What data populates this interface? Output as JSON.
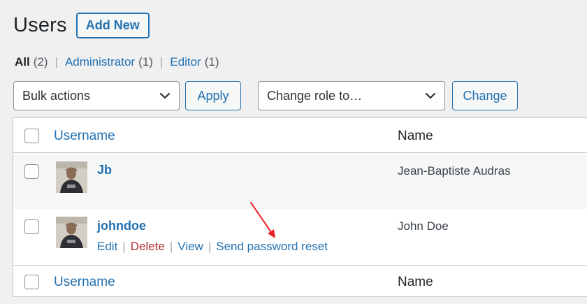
{
  "header": {
    "title": "Users",
    "add_new_label": "Add New"
  },
  "views": [
    {
      "label": "All",
      "count": "(2)",
      "current": true
    },
    {
      "label": "Administrator",
      "count": "(1)",
      "current": false
    },
    {
      "label": "Editor",
      "count": "(1)",
      "current": false
    }
  ],
  "tablenav": {
    "bulk_select": "Bulk actions",
    "apply_label": "Apply",
    "role_select": "Change role to…",
    "change_label": "Change"
  },
  "table": {
    "columns": {
      "username": "Username",
      "name": "Name"
    },
    "rows": [
      {
        "username": "Jb",
        "name": "Jean-Baptiste Audras",
        "actions_visible": false
      },
      {
        "username": "johndoe",
        "name": "John Doe",
        "actions_visible": true
      }
    ],
    "row_actions": {
      "edit": "Edit",
      "delete": "Delete",
      "view": "View",
      "reset": "Send password reset"
    }
  },
  "colors": {
    "accent": "#2271b1",
    "danger": "#b32d2e",
    "arrow": "#e8202a"
  },
  "icons": {
    "select_chevron": "chevron-down-icon",
    "pointer": "red-arrow-annotation"
  }
}
